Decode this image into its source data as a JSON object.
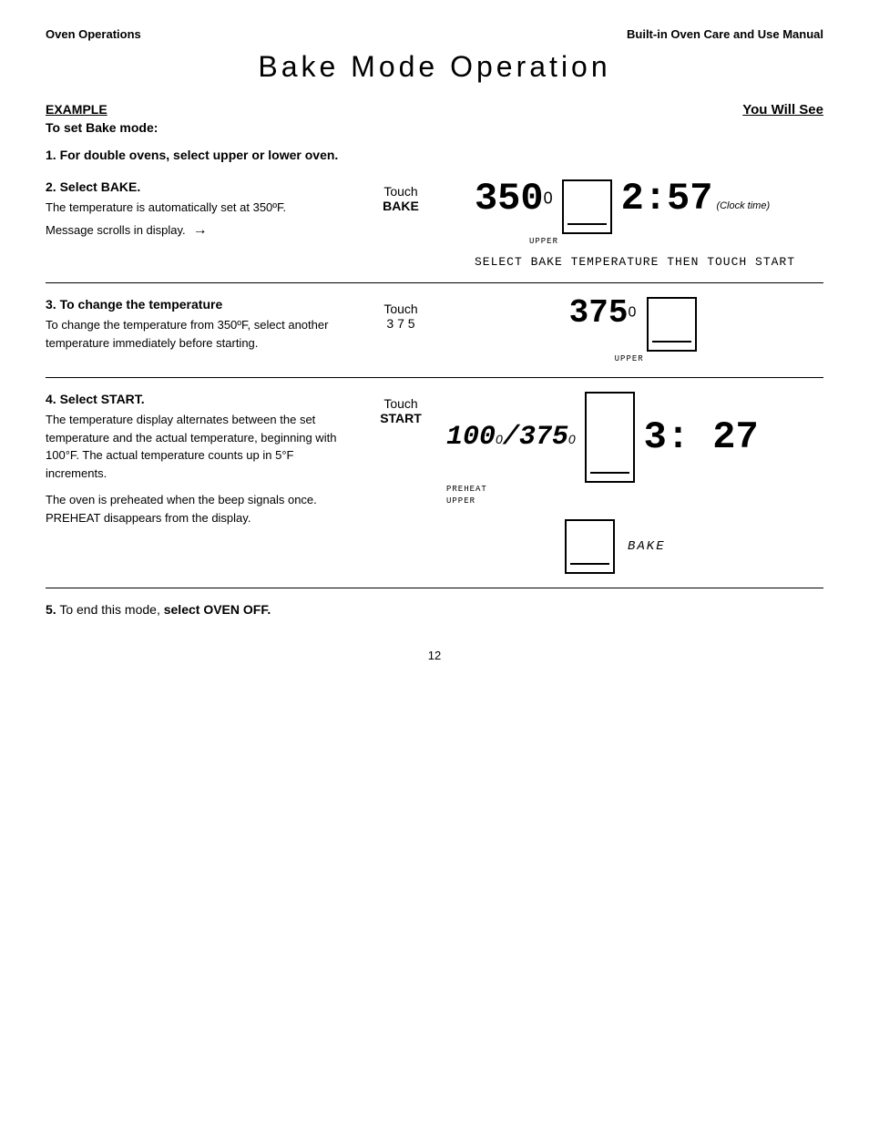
{
  "header": {
    "left": "Oven Operations",
    "right": "Built-in Oven Care and Use Manual"
  },
  "title": "Bake  Mode  Operation",
  "example": {
    "label": "EXAMPLE",
    "to_set": "To set Bake mode:",
    "you_will_see": "You Will See"
  },
  "step1": {
    "number": "1.",
    "text": "For double ovens, select upper or lower oven."
  },
  "step2": {
    "number": "2.",
    "title": "Select BAKE.",
    "body": "The temperature is automatically set at 350ºF.",
    "touch_line1": "Touch",
    "touch_line2": "BAKE",
    "temp": "350",
    "degree": "0",
    "clock": "2:57",
    "clock_label": "(Clock time)",
    "upper_label": "UPPER",
    "scroll_text": "Message scrolls in display.",
    "scroll_arrow": "→",
    "select_msg": "SELECT BAKE TEMPERATURE THEN TOUCH START"
  },
  "step3": {
    "number": "3.",
    "title": "To change the temperature",
    "body": "To change the temperature from 350ºF, select another temperature immediately before starting.",
    "touch_line1": "Touch",
    "touch_line2": "3 7 5",
    "temp": "375",
    "degree": "0",
    "upper_label": "UPPER"
  },
  "step4": {
    "number": "4.",
    "title": "Select  START.",
    "body1": "The temperature display alternates between the set temperature and the actual temperature, beginning with 100°F.  The actual temperature counts up in 5°F increments.",
    "body2": "The oven is preheated when the beep signals once.  PREHEAT disappears from the display.",
    "touch_line1": "Touch",
    "touch_line2": "START",
    "temp_actual": "100",
    "degree_actual": "0",
    "temp_set": "375",
    "degree_set": "0",
    "preheat_label": "PREHEAT",
    "upper_label": "UPPER",
    "clock": "3: 27",
    "bake_label": "BAKE"
  },
  "step5": {
    "number": "5.",
    "text_normal": "To end this mode,",
    "text_bold": "select OVEN OFF."
  },
  "page_number": "12"
}
